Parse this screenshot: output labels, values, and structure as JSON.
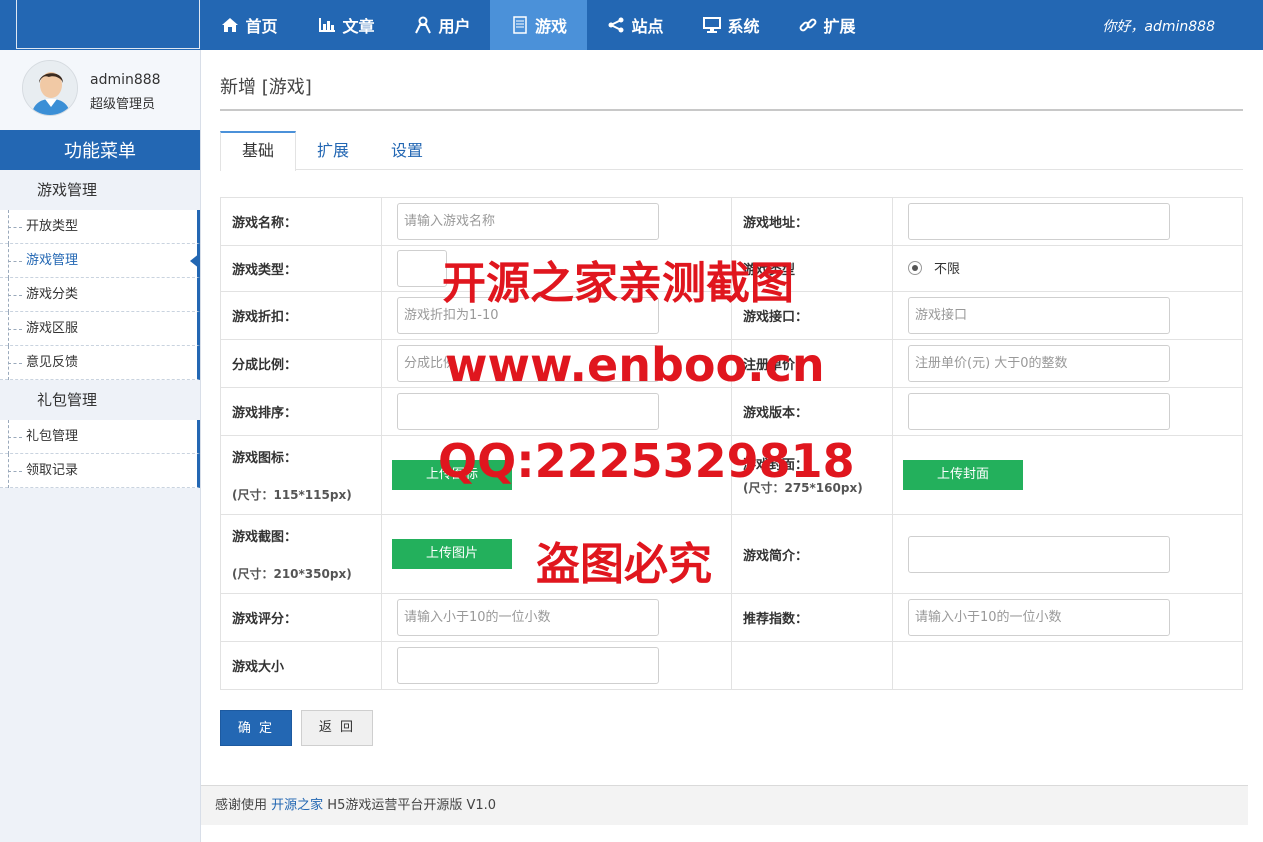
{
  "header": {
    "nav": [
      {
        "label": "首页",
        "icon": "home-icon"
      },
      {
        "label": "文章",
        "icon": "bar-chart-icon"
      },
      {
        "label": "用户",
        "icon": "user-icon"
      },
      {
        "label": "游戏",
        "icon": "document-icon",
        "active": true
      },
      {
        "label": "站点",
        "icon": "share-icon"
      },
      {
        "label": "系统",
        "icon": "monitor-icon"
      },
      {
        "label": "扩展",
        "icon": "link-icon"
      }
    ],
    "greeting": "你好，",
    "username": "admin888"
  },
  "sidebar": {
    "profile": {
      "name": "admin888",
      "role": "超级管理员"
    },
    "menu_title": "功能菜单",
    "groups": [
      {
        "title": "游戏管理",
        "items": [
          "开放类型",
          "游戏管理",
          "游戏分类",
          "游戏区服",
          "意见反馈"
        ],
        "active_index": 1
      },
      {
        "title": "礼包管理",
        "items": [
          "礼包管理",
          "领取记录"
        ]
      }
    ]
  },
  "main": {
    "title": "新增 [游戏]",
    "tabs": [
      "基础",
      "扩展",
      "设置"
    ],
    "form": {
      "game_name": {
        "label": "游戏名称：",
        "placeholder": "请输入游戏名称"
      },
      "game_url": {
        "label": "游戏地址：",
        "placeholder": ""
      },
      "game_type": {
        "label": "游戏类型：",
        "value": ""
      },
      "game_limit": {
        "label": "游戏类型",
        "radio": "不限"
      },
      "discount": {
        "label": "游戏折扣：",
        "placeholder": "游戏折扣为1-10"
      },
      "api": {
        "label": "游戏接口：",
        "placeholder": "游戏接口"
      },
      "ratio": {
        "label": "分成比例：",
        "placeholder": "分成比例"
      },
      "reg_price": {
        "label": "注册单价",
        "placeholder": "注册单价(元) 大于0的整数"
      },
      "sort": {
        "label": "游戏排序：",
        "placeholder": ""
      },
      "version": {
        "label": "游戏版本：",
        "placeholder": ""
      },
      "icon": {
        "label": "游戏图标：",
        "size": "(尺寸：115*115px)",
        "button": "上传图标"
      },
      "cover": {
        "label": "游戏封面：",
        "size": "(尺寸：275*160px)",
        "button": "上传封面"
      },
      "screenshot": {
        "label": "游戏截图：",
        "size": "(尺寸：210*350px)",
        "button": "上传图片"
      },
      "intro": {
        "label": "游戏简介：",
        "placeholder": ""
      },
      "score": {
        "label": "游戏评分：",
        "placeholder": "请输入小于10的一位小数"
      },
      "recommend": {
        "label": "推荐指数：",
        "placeholder": "请输入小于10的一位小数"
      },
      "game_size": {
        "label": "游戏大小",
        "placeholder": ""
      }
    },
    "buttons": {
      "ok": "确 定",
      "back": "返 回"
    }
  },
  "footer": {
    "prefix": "感谢使用 ",
    "link": "开源之家",
    "suffix": " H5游戏运营平台开源版 V1.0"
  },
  "watermark": {
    "line1": "开源之家亲测截图",
    "line2": "www.enboo.cn",
    "line3": "QQ:2225329818",
    "line4": "盗图必究"
  },
  "colors": {
    "brand": "#2367b3",
    "nav_active": "#4b91d9",
    "upload": "#23b05c",
    "watermark": "#e0161e"
  }
}
